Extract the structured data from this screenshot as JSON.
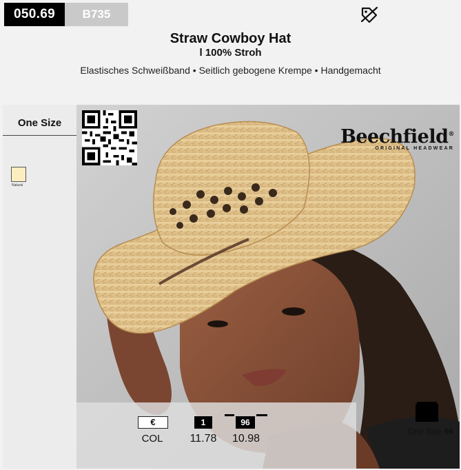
{
  "header": {
    "article_number": "050.69",
    "brand_code": "B735",
    "tag_icon": "price-tag-crossed-icon"
  },
  "product": {
    "title": "Straw Cowboy Hat",
    "material": "l 100% Stroh",
    "features": "Elastisches Schweißband • Seitlich gebogene Krempe • Handgemacht"
  },
  "sizes": {
    "label": "One Size"
  },
  "colors": [
    {
      "name": "Natural",
      "hex": "#fdeec0"
    }
  ],
  "brand": {
    "name": "Beechfield",
    "registered": "®",
    "subtitle": "ORIGINAL HEADWEAR"
  },
  "pricing": {
    "currency": "€",
    "col_label": "COL",
    "tiers": [
      {
        "qty": "1",
        "price": "11.78"
      },
      {
        "qty": "96",
        "price": "10.98"
      }
    ]
  },
  "carton": {
    "label": "One Size",
    "qty": "96"
  }
}
